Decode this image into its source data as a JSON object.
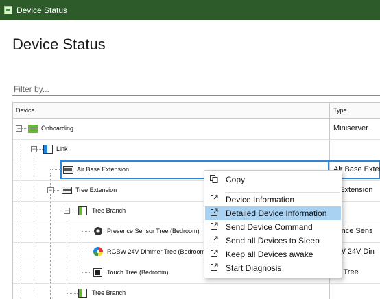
{
  "window": {
    "title": "Device Status"
  },
  "page": {
    "title": "Device Status"
  },
  "filter": {
    "placeholder": "Filter by..."
  },
  "table": {
    "columns": [
      "Device",
      "Type"
    ],
    "rows": [
      {
        "label": "Onboarding",
        "type": "Miniserver"
      },
      {
        "label": "Link",
        "type": ""
      },
      {
        "label": "Air Base Extension",
        "type": "Air Base Exten"
      },
      {
        "label": "Tree Extension",
        "type": "e Extension"
      },
      {
        "label": "Tree Branch",
        "type": ""
      },
      {
        "label": "Presence Sensor Tree (Bedroom)",
        "type": "sence Sens"
      },
      {
        "label": "RGBW 24V Dimmer Tree (Bedroom",
        "type": "BW 24V Din"
      },
      {
        "label": "Touch Tree (Bedroom)",
        "type": "ch Tree"
      },
      {
        "label": "Tree Branch",
        "type": ""
      }
    ]
  },
  "context_menu": {
    "items": [
      {
        "label": "Copy",
        "icon": "copy-icon"
      },
      {
        "label": "Device Information",
        "icon": "external-link-icon"
      },
      {
        "label": "Detailed Device Information",
        "icon": "external-link-icon"
      },
      {
        "label": "Send Device Command",
        "icon": "external-link-icon"
      },
      {
        "label": "Send all Devices to Sleep",
        "icon": "external-link-icon"
      },
      {
        "label": "Keep all Devices awake",
        "icon": "external-link-icon"
      },
      {
        "label": "Start Diagnosis",
        "icon": "external-link-icon"
      }
    ],
    "highlighted": "Detailed Device Information"
  },
  "colors": {
    "titlebar": "#2e5b2a",
    "selection_border": "#2d86d6",
    "menu_highlight": "#a9d1f2",
    "brand_green": "#69b43a"
  }
}
